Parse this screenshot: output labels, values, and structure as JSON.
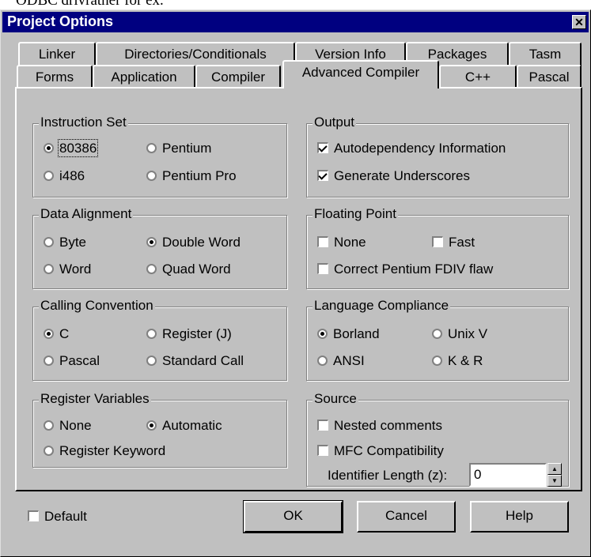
{
  "background_text": "ODBC drivrather for ex.",
  "window": {
    "title": "Project Options",
    "close_glyph": "✕"
  },
  "tabs": {
    "row1": [
      {
        "label": "Linker"
      },
      {
        "label": "Directories/Conditionals"
      },
      {
        "label": "Version Info"
      },
      {
        "label": "Packages"
      },
      {
        "label": "Tasm"
      }
    ],
    "row2": [
      {
        "label": "Forms"
      },
      {
        "label": "Application"
      },
      {
        "label": "Compiler"
      },
      {
        "label": "Advanced Compiler",
        "active": true
      },
      {
        "label": "C++"
      },
      {
        "label": "Pascal"
      }
    ]
  },
  "instruction_set": {
    "title": "Instruction Set",
    "options": [
      {
        "label": "80386",
        "selected": true
      },
      {
        "label": "Pentium",
        "selected": false
      },
      {
        "label": "i486",
        "selected": false
      },
      {
        "label": "Pentium Pro",
        "selected": false
      }
    ]
  },
  "output": {
    "title": "Output",
    "options": [
      {
        "label": "Autodependency Information",
        "checked": true
      },
      {
        "label": "Generate Underscores",
        "checked": true
      }
    ]
  },
  "data_alignment": {
    "title": "Data Alignment",
    "options": [
      {
        "label": "Byte",
        "selected": false
      },
      {
        "label": "Double Word",
        "selected": true
      },
      {
        "label": "Word",
        "selected": false
      },
      {
        "label": "Quad Word",
        "selected": false
      }
    ]
  },
  "floating_point": {
    "title": "Floating Point",
    "options": [
      {
        "label": "None",
        "checked": false
      },
      {
        "label": "Fast",
        "checked": false
      },
      {
        "label": "Correct Pentium FDIV flaw",
        "checked": false
      }
    ]
  },
  "calling_convention": {
    "title": "Calling Convention",
    "options": [
      {
        "label": "C",
        "selected": true
      },
      {
        "label": "Register (J)",
        "selected": false
      },
      {
        "label": "Pascal",
        "selected": false
      },
      {
        "label": "Standard Call",
        "selected": false
      }
    ]
  },
  "language_compliance": {
    "title": "Language Compliance",
    "options": [
      {
        "label": "Borland",
        "selected": true
      },
      {
        "label": "Unix V",
        "selected": false
      },
      {
        "label": "ANSI",
        "selected": false
      },
      {
        "label": "K & R",
        "selected": false
      }
    ]
  },
  "register_variables": {
    "title": "Register Variables",
    "options": [
      {
        "label": "None",
        "selected": false
      },
      {
        "label": "Automatic",
        "selected": true
      },
      {
        "label": "Register Keyword",
        "selected": false
      }
    ]
  },
  "source": {
    "title": "Source",
    "options": [
      {
        "label": "Nested comments",
        "checked": false
      },
      {
        "label": "MFC Compatibility",
        "checked": false
      }
    ],
    "identifier_length": {
      "label": "Identifier Length (z):",
      "value": "0"
    }
  },
  "footer": {
    "default_label": "Default",
    "default_checked": false,
    "ok_label": "OK",
    "cancel_label": "Cancel",
    "help_label": "Help"
  }
}
